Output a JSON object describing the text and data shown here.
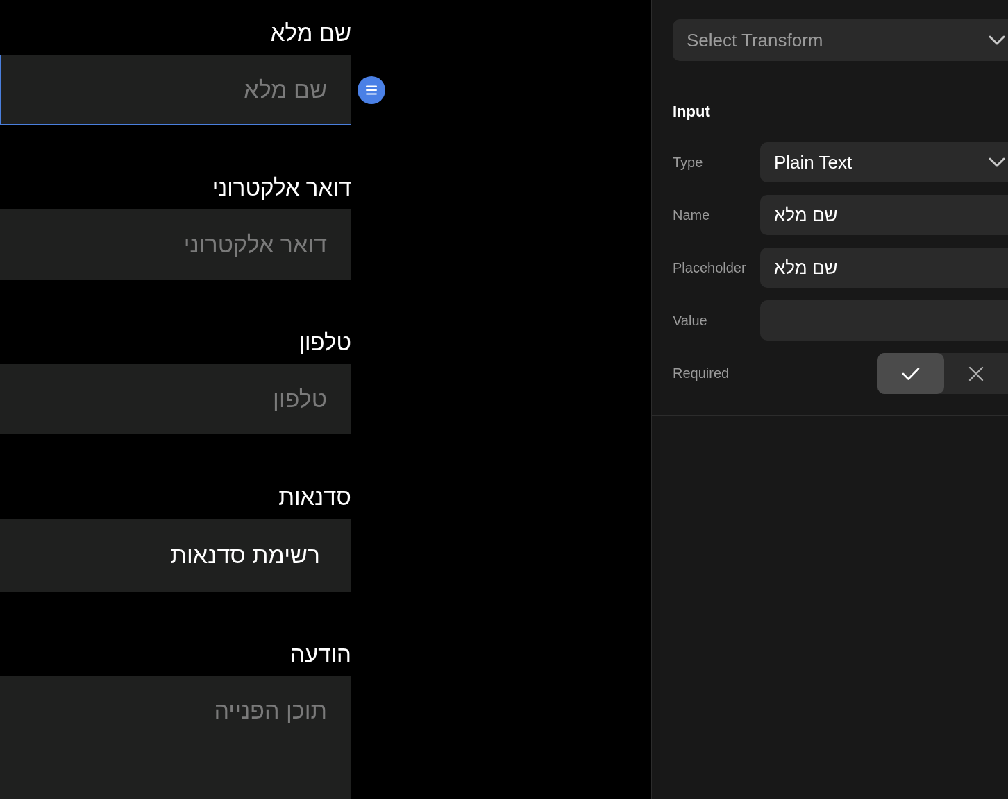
{
  "form": {
    "fields": [
      {
        "kind": "input",
        "label": "שם מלא",
        "placeholder": "שם מלא",
        "selected": true
      },
      {
        "kind": "input",
        "label": "דואר אלקטרוני",
        "placeholder": "דואר אלקטרוני",
        "selected": false
      },
      {
        "kind": "input",
        "label": "טלפון",
        "placeholder": "טלפון",
        "selected": false
      },
      {
        "kind": "select",
        "label": "סדנאות",
        "value": "רשימת סדנאות",
        "selected": false
      },
      {
        "kind": "textarea",
        "label": "הודעה",
        "placeholder": "תוכן הפנייה",
        "selected": false
      }
    ]
  },
  "inspector": {
    "transform": {
      "placeholder": "Select Transform"
    },
    "section_title": "Input",
    "properties": [
      {
        "kind": "select",
        "label": "Type",
        "value": "Plain Text"
      },
      {
        "kind": "text",
        "label": "Name",
        "value": "שם מלא"
      },
      {
        "kind": "text",
        "label": "Placeholder",
        "value": "שם מלא"
      },
      {
        "kind": "text",
        "label": "Value"
      },
      {
        "kind": "toggle",
        "label": "Required",
        "checked": true
      }
    ]
  }
}
